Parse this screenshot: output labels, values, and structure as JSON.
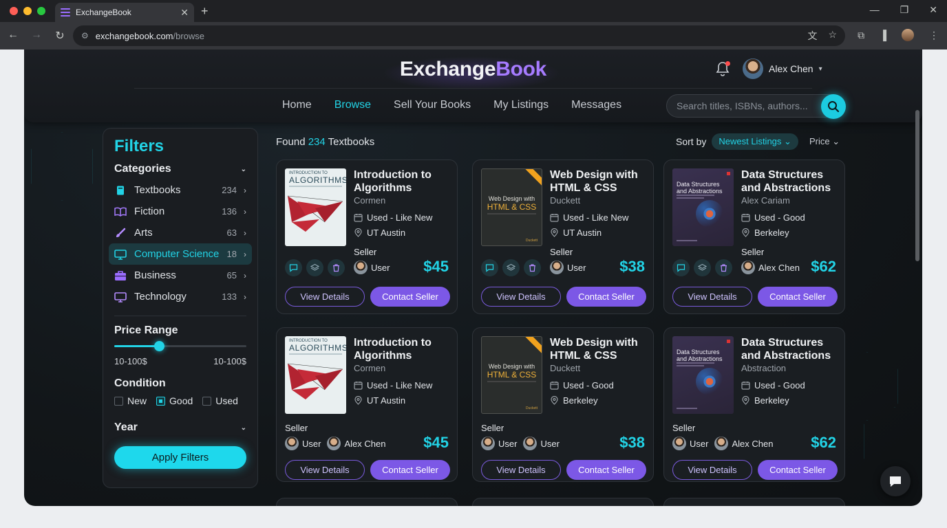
{
  "browser": {
    "tab_title": "ExchangeBook",
    "url_host": "exchangebook.com",
    "url_path": "/browse"
  },
  "header": {
    "logo_a": "Exchange",
    "logo_b": "Book",
    "user_name": "Alex Chen",
    "nav": [
      "Home",
      "Browse",
      "Sell Your Books",
      "My Listings",
      "Messages"
    ],
    "active_nav": "Browse",
    "search_placeholder": "Search titles, ISBNs, authors..."
  },
  "filters": {
    "title": "Filters",
    "categories_label": "Categories",
    "categories": [
      {
        "name": "Textbooks",
        "count": "234",
        "icon": "book-icon"
      },
      {
        "name": "Fiction",
        "count": "136",
        "icon": "open-book-icon"
      },
      {
        "name": "Arts",
        "count": "63",
        "icon": "brush-icon"
      },
      {
        "name": "Computer Science",
        "count": "18",
        "icon": "monitor-icon",
        "active": true
      },
      {
        "name": "Business",
        "count": "65",
        "icon": "briefcase-icon"
      },
      {
        "name": "Technology",
        "count": "133",
        "icon": "desktop-icon"
      }
    ],
    "price_range_label": "Price Range",
    "price_min_label": "10-100$",
    "price_max_label": "10-100$",
    "price_slider_level": 0.34,
    "condition_label": "Condition",
    "conditions": [
      {
        "label": "New",
        "checked": false
      },
      {
        "label": "Good",
        "checked": true
      },
      {
        "label": "Used",
        "checked": false
      }
    ],
    "year_label": "Year",
    "apply_label": "Apply Filters"
  },
  "results": {
    "found_prefix": "Found",
    "found_count": "234",
    "found_suffix": "Textbooks",
    "sort_label": "Sort by",
    "sort_value": "Newest Listings",
    "price_label": "Price"
  },
  "cards": [
    {
      "title": "Introduction to Algorithms",
      "author": "Cormen",
      "condition": "Used - Like New",
      "location": "UT Austin",
      "seller_label": "Seller",
      "sellers": [
        "User"
      ],
      "price": "$45",
      "view_label": "View Details",
      "contact_label": "Contact Seller",
      "cover": "algo"
    },
    {
      "title": "Web Design with HTML & CSS",
      "author": "Duckett",
      "condition": "Used - Like New",
      "location": "UT Austin",
      "seller_label": "Seller",
      "sellers": [
        "User"
      ],
      "price": "$38",
      "view_label": "View Details",
      "contact_label": "Contact Seller",
      "cover": "web"
    },
    {
      "title": "Data Structures and Abstractions",
      "author": "Alex Cariam",
      "condition": "Used - Good",
      "location": "Berkeley",
      "seller_label": "Seller",
      "sellers": [
        "Alex Chen"
      ],
      "price": "$62",
      "view_label": "View Details",
      "contact_label": "Contact Seller",
      "cover": "ds"
    },
    {
      "title": "Introduction to Algorithms",
      "author": "Cormen",
      "condition": "Used - Like New",
      "location": "UT Austin",
      "seller_label": "Seller",
      "sellers": [
        "User",
        "Alex Chen"
      ],
      "price": "$45",
      "view_label": "View Details",
      "contact_label": "Contact Seller",
      "cover": "algo"
    },
    {
      "title": "Web Design with HTML & CSS",
      "author": "Duckett",
      "condition": "Used - Good",
      "location": "Berkeley",
      "seller_label": "Seller",
      "sellers": [
        "User",
        "User"
      ],
      "price": "$38",
      "view_label": "View Details",
      "contact_label": "Contact Seller",
      "cover": "web"
    },
    {
      "title": "Data Structures and Abstractions",
      "author": "Abstraction",
      "condition": "Used - Good",
      "location": "Berkeley",
      "seller_label": "Seller",
      "sellers": [
        "User",
        "Alex Chen"
      ],
      "price": "$62",
      "view_label": "View Details",
      "contact_label": "Contact Seller",
      "cover": "ds"
    }
  ],
  "covers": {
    "algo": {
      "line1": "INTRODUCTION TO",
      "line2": "ALGORITHMS"
    },
    "web": {
      "line1": "Web Design with",
      "line2": "HTML & CSS",
      "line3": "Duckett"
    },
    "ds": {
      "line1": "Data Structures",
      "line2": "and Abstractions"
    }
  },
  "colors": {
    "accent": "#22d3e6",
    "purple": "#7c58e6",
    "bg": "#121619"
  }
}
